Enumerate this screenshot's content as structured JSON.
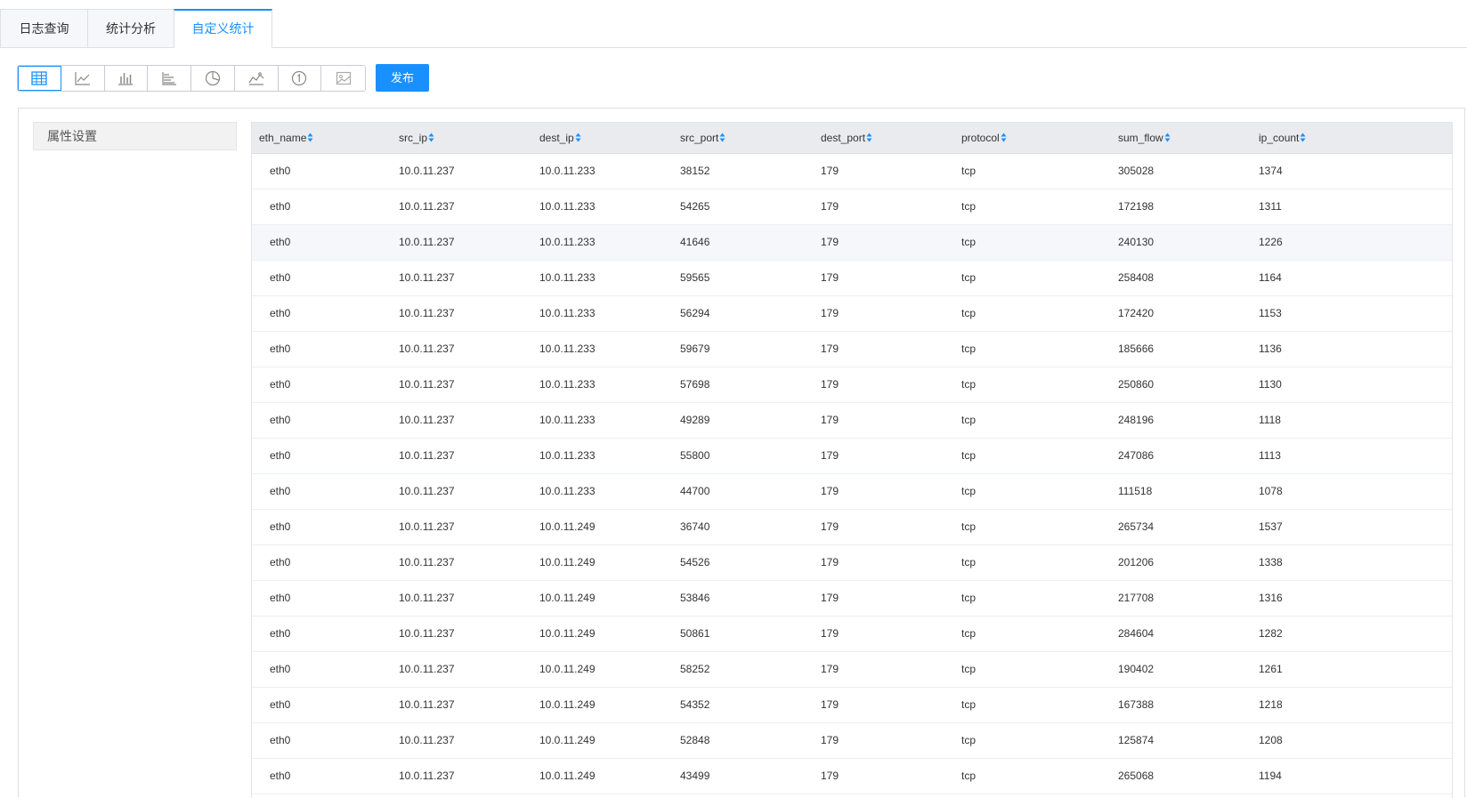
{
  "tabs": [
    {
      "label": "日志查询"
    },
    {
      "label": "统计分析"
    },
    {
      "label": "自定义统计"
    }
  ],
  "toolbar": {
    "tools": [
      "table-icon",
      "line-chart-icon",
      "bar-chart-icon",
      "horizontal-bar-icon",
      "pie-chart-icon",
      "area-chart-icon",
      "number-icon",
      "image-icon"
    ],
    "publish_label": "发布"
  },
  "sidebar": {
    "attr_label": "属性设置"
  },
  "colors": {
    "accent": "#1890ff",
    "header_bg": "#e9ebee"
  },
  "table": {
    "columns": [
      "eth_name",
      "src_ip",
      "dest_ip",
      "src_port",
      "dest_port",
      "protocol",
      "sum_flow",
      "ip_count"
    ],
    "rows": [
      [
        "eth0",
        "10.0.11.237",
        "10.0.11.233",
        "38152",
        "179",
        "tcp",
        "305028",
        "1374"
      ],
      [
        "eth0",
        "10.0.11.237",
        "10.0.11.233",
        "54265",
        "179",
        "tcp",
        "172198",
        "1311"
      ],
      [
        "eth0",
        "10.0.11.237",
        "10.0.11.233",
        "41646",
        "179",
        "tcp",
        "240130",
        "1226"
      ],
      [
        "eth0",
        "10.0.11.237",
        "10.0.11.233",
        "59565",
        "179",
        "tcp",
        "258408",
        "1164"
      ],
      [
        "eth0",
        "10.0.11.237",
        "10.0.11.233",
        "56294",
        "179",
        "tcp",
        "172420",
        "1153"
      ],
      [
        "eth0",
        "10.0.11.237",
        "10.0.11.233",
        "59679",
        "179",
        "tcp",
        "185666",
        "1136"
      ],
      [
        "eth0",
        "10.0.11.237",
        "10.0.11.233",
        "57698",
        "179",
        "tcp",
        "250860",
        "1130"
      ],
      [
        "eth0",
        "10.0.11.237",
        "10.0.11.233",
        "49289",
        "179",
        "tcp",
        "248196",
        "1118"
      ],
      [
        "eth0",
        "10.0.11.237",
        "10.0.11.233",
        "55800",
        "179",
        "tcp",
        "247086",
        "1113"
      ],
      [
        "eth0",
        "10.0.11.237",
        "10.0.11.233",
        "44700",
        "179",
        "tcp",
        "111518",
        "1078"
      ],
      [
        "eth0",
        "10.0.11.237",
        "10.0.11.249",
        "36740",
        "179",
        "tcp",
        "265734",
        "1537"
      ],
      [
        "eth0",
        "10.0.11.237",
        "10.0.11.249",
        "54526",
        "179",
        "tcp",
        "201206",
        "1338"
      ],
      [
        "eth0",
        "10.0.11.237",
        "10.0.11.249",
        "53846",
        "179",
        "tcp",
        "217708",
        "1316"
      ],
      [
        "eth0",
        "10.0.11.237",
        "10.0.11.249",
        "50861",
        "179",
        "tcp",
        "284604",
        "1282"
      ],
      [
        "eth0",
        "10.0.11.237",
        "10.0.11.249",
        "58252",
        "179",
        "tcp",
        "190402",
        "1261"
      ],
      [
        "eth0",
        "10.0.11.237",
        "10.0.11.249",
        "54352",
        "179",
        "tcp",
        "167388",
        "1218"
      ],
      [
        "eth0",
        "10.0.11.237",
        "10.0.11.249",
        "52848",
        "179",
        "tcp",
        "125874",
        "1208"
      ],
      [
        "eth0",
        "10.0.11.237",
        "10.0.11.249",
        "43499",
        "179",
        "tcp",
        "265068",
        "1194"
      ]
    ]
  }
}
